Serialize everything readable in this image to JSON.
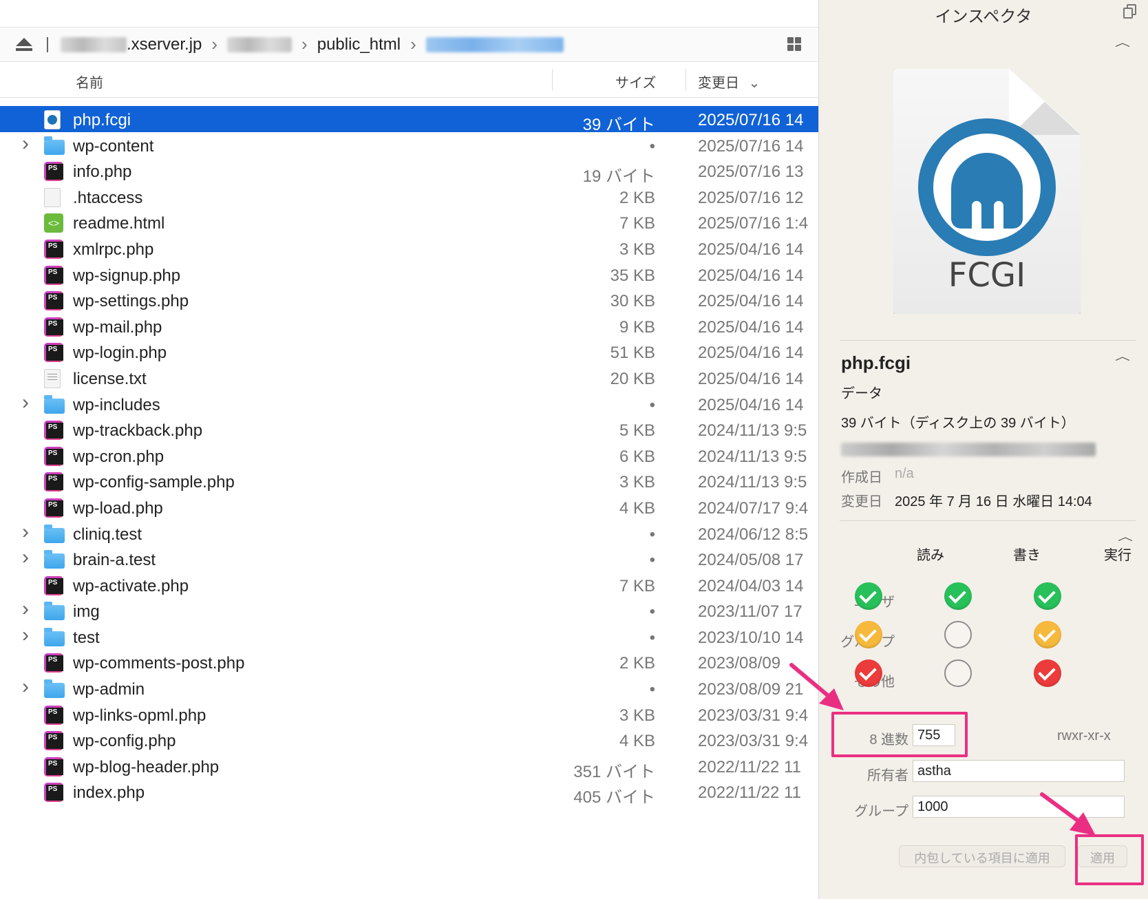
{
  "path_bar": {
    "host_suffix": ".xserver.jp",
    "public_html": "public_html"
  },
  "columns": {
    "name": "名前",
    "size": "サイズ",
    "modified": "変更日"
  },
  "files": [
    {
      "name": "php.fcgi",
      "size": "39 バイト",
      "date": "2025/07/16 14",
      "type": "fcgi",
      "folder": false,
      "selected": true
    },
    {
      "name": "wp-content",
      "size": "•",
      "date": "2025/07/16 14",
      "type": "folder",
      "folder": true
    },
    {
      "name": "info.php",
      "size": "19 バイト",
      "date": "2025/07/16 13",
      "type": "php",
      "folder": false
    },
    {
      "name": ".htaccess",
      "size": "2 KB",
      "date": "2025/07/16 12",
      "type": "blank",
      "folder": false
    },
    {
      "name": "readme.html",
      "size": "7 KB",
      "date": "2025/07/16 1:4",
      "type": "html",
      "folder": false
    },
    {
      "name": "xmlrpc.php",
      "size": "3 KB",
      "date": "2025/04/16 14",
      "type": "php",
      "folder": false
    },
    {
      "name": "wp-signup.php",
      "size": "35 KB",
      "date": "2025/04/16 14",
      "type": "php",
      "folder": false
    },
    {
      "name": "wp-settings.php",
      "size": "30 KB",
      "date": "2025/04/16 14",
      "type": "php",
      "folder": false
    },
    {
      "name": "wp-mail.php",
      "size": "9 KB",
      "date": "2025/04/16 14",
      "type": "php",
      "folder": false
    },
    {
      "name": "wp-login.php",
      "size": "51 KB",
      "date": "2025/04/16 14",
      "type": "php",
      "folder": false
    },
    {
      "name": "license.txt",
      "size": "20 KB",
      "date": "2025/04/16 14",
      "type": "txt",
      "folder": false
    },
    {
      "name": "wp-includes",
      "size": "•",
      "date": "2025/04/16 14",
      "type": "folder",
      "folder": true
    },
    {
      "name": "wp-trackback.php",
      "size": "5 KB",
      "date": "2024/11/13 9:5",
      "type": "php",
      "folder": false
    },
    {
      "name": "wp-cron.php",
      "size": "6 KB",
      "date": "2024/11/13 9:5",
      "type": "php",
      "folder": false
    },
    {
      "name": "wp-config-sample.php",
      "size": "3 KB",
      "date": "2024/11/13 9:5",
      "type": "php",
      "folder": false
    },
    {
      "name": "wp-load.php",
      "size": "4 KB",
      "date": "2024/07/17 9:4",
      "type": "php",
      "folder": false
    },
    {
      "name": "cliniq.test",
      "size": "•",
      "date": "2024/06/12 8:5",
      "type": "folder",
      "folder": true
    },
    {
      "name": "brain-a.test",
      "size": "•",
      "date": "2024/05/08 17",
      "type": "folder",
      "folder": true
    },
    {
      "name": "wp-activate.php",
      "size": "7 KB",
      "date": "2024/04/03 14",
      "type": "php",
      "folder": false
    },
    {
      "name": "img",
      "size": "•",
      "date": "2023/11/07 17",
      "type": "folder",
      "folder": true
    },
    {
      "name": "test",
      "size": "•",
      "date": "2023/10/10 14",
      "type": "folder",
      "folder": true
    },
    {
      "name": "wp-comments-post.php",
      "size": "2 KB",
      "date": "2023/08/09",
      "type": "php",
      "folder": false
    },
    {
      "name": "wp-admin",
      "size": "•",
      "date": "2023/08/09 21",
      "type": "folder",
      "folder": true
    },
    {
      "name": "wp-links-opml.php",
      "size": "3 KB",
      "date": "2023/03/31 9:4",
      "type": "php",
      "folder": false
    },
    {
      "name": "wp-config.php",
      "size": "4 KB",
      "date": "2023/03/31 9:4",
      "type": "php",
      "folder": false
    },
    {
      "name": "wp-blog-header.php",
      "size": "351 バイト",
      "date": "2022/11/22 11",
      "type": "php",
      "folder": false
    },
    {
      "name": "index.php",
      "size": "405 バイト",
      "date": "2022/11/22 11",
      "type": "php",
      "folder": false
    }
  ],
  "inspector": {
    "title": "インスペクタ",
    "preview_label": "FCGI",
    "file_name": "php.fcgi",
    "kind": "データ",
    "size_text": "39 バイト（ディスク上の 39 バイト）",
    "created_label": "作成日",
    "created_value": "n/a",
    "modified_label": "変更日",
    "modified_value": "2025 年 7 月 16 日 水曜日 14:04",
    "permissions": {
      "read": "読み",
      "write": "書き",
      "execute": "実行",
      "user": "ユーザ",
      "group": "グループ",
      "other": "その他",
      "matrix": [
        [
          "green",
          "green",
          "green"
        ],
        [
          "yellow",
          "off",
          "yellow"
        ],
        [
          "red",
          "off",
          "red"
        ]
      ]
    },
    "octal_label": "8 進数",
    "octal_value": "755",
    "symbolic": "rwxr-xr-x",
    "owner_label": "所有者",
    "owner_value": "astha",
    "group_label": "グループ",
    "group_value": "1000",
    "apply_enclosed_label": "内包している項目に適用",
    "apply_label": "適用"
  },
  "colors": {
    "selection": "#1062d6",
    "highlight": "#ea2f82"
  }
}
